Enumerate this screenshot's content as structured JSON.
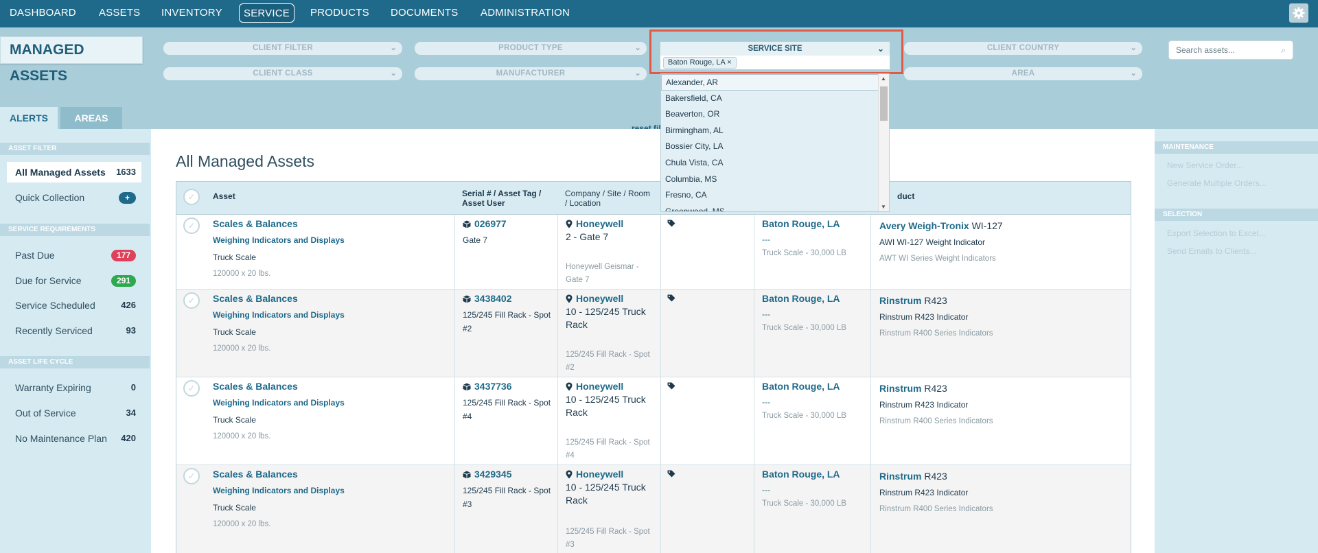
{
  "nav": {
    "items": [
      "DASHBOARD",
      "ASSETS",
      "INVENTORY",
      "SERVICE",
      "PRODUCTS",
      "DOCUMENTS",
      "ADMINISTRATION"
    ],
    "active": "SERVICE",
    "settings_icon": "gear-icon"
  },
  "page_title": "MANAGED ASSETS",
  "filters": {
    "client_filter": "CLIENT FILTER",
    "product_type": "PRODUCT TYPE",
    "service_site": "SERVICE SITE",
    "client_country": "CLIENT COUNTRY",
    "client_class": "CLIENT CLASS",
    "manufacturer": "MANUFACTURER",
    "area": "AREA",
    "selected_site": "Baton Rouge, LA",
    "search_placeholder": "Search assets...",
    "reset_label": "reset fil"
  },
  "site_options": [
    "Alexander, AR",
    "Bakersfield, CA",
    "Beaverton, OR",
    "Birmingham, AL",
    "Bossier City, LA",
    "Chula Vista, CA",
    "Columbia, MS",
    "Fresno, CA",
    "Greenwood, MS"
  ],
  "tabs": [
    "ALERTS",
    "AREAS"
  ],
  "sidebar": {
    "asset_filter_header": "ASSET FILTER",
    "all_assets": {
      "label": "All Managed Assets",
      "count": "1633"
    },
    "quick_collection": {
      "label": "Quick Collection",
      "badge": "+"
    },
    "service_req_header": "SERVICE REQUIREMENTS",
    "past_due": {
      "label": "Past Due",
      "count": "177"
    },
    "due_for_service": {
      "label": "Due for Service",
      "count": "291"
    },
    "service_scheduled": {
      "label": "Service Scheduled",
      "count": "426"
    },
    "recently_serviced": {
      "label": "Recently Serviced",
      "count": "93"
    },
    "life_cycle_header": "ASSET LIFE CYCLE",
    "warranty_expiring": {
      "label": "Warranty Expiring",
      "count": "0"
    },
    "out_of_service": {
      "label": "Out of Service",
      "count": "34"
    },
    "no_maintenance": {
      "label": "No Maintenance Plan",
      "count": "420"
    },
    "colors": {
      "red": "#e0415a",
      "green": "#2fa84f",
      "navy": "#1f6a8a"
    }
  },
  "main": {
    "title": "All Managed Assets",
    "headers": {
      "asset": "Asset",
      "serial_line1": "Serial # / Asset Tag /",
      "serial_line2": "Asset User",
      "company_line1": "Company / Site / Room",
      "company_line2": "/ Location",
      "product": "duct"
    },
    "rows": [
      {
        "asset": "Scales & Balances",
        "category": "Weighing Indicators and Displays",
        "type": "Truck Scale",
        "capacity": "120000 x 20 lbs.",
        "serial": "026977",
        "tag_line1": "Gate 7",
        "tag_line2": "",
        "company": "Honeywell",
        "room_line1": "2 - Gate 7",
        "room_line2": "",
        "loc_line1": "Honeywell Geismar -",
        "loc_line2": "Gate 7",
        "site": "Baton Rouge, LA",
        "site_dash": "---",
        "site_desc": "Truck Scale - 30,000 LB",
        "brand": "Avery Weigh-Tronix",
        "model": "WI-127",
        "prod_name": "AWI WI-127 Weight Indicator",
        "series": "AWT WI Series Weight Indicators"
      },
      {
        "asset": "Scales & Balances",
        "category": "Weighing Indicators and Displays",
        "type": "Truck Scale",
        "capacity": "120000 x 20 lbs.",
        "serial": "3438402",
        "tag_line1": "125/245 Fill Rack - Spot",
        "tag_line2": "#2",
        "company": "Honeywell",
        "room_line1": "10 - 125/245 Truck",
        "room_line2": "Rack",
        "loc_line1": "125/245 Fill Rack - Spot",
        "loc_line2": "#2",
        "site": "Baton Rouge, LA",
        "site_dash": "---",
        "site_desc": "Truck Scale - 30,000 LB",
        "brand": "Rinstrum",
        "model": "R423",
        "prod_name": "Rinstrum R423 Indicator",
        "series": "Rinstrum R400 Series Indicators"
      },
      {
        "asset": "Scales & Balances",
        "category": "Weighing Indicators and Displays",
        "type": "Truck Scale",
        "capacity": "120000 x 20 lbs.",
        "serial": "3437736",
        "tag_line1": "125/245 Fill Rack - Spot",
        "tag_line2": "#4",
        "company": "Honeywell",
        "room_line1": "10 - 125/245 Truck",
        "room_line2": "Rack",
        "loc_line1": "125/245 Fill Rack - Spot",
        "loc_line2": "#4",
        "site": "Baton Rouge, LA",
        "site_dash": "---",
        "site_desc": "Truck Scale - 30,000 LB",
        "brand": "Rinstrum",
        "model": "R423",
        "prod_name": "Rinstrum R423 Indicator",
        "series": "Rinstrum R400 Series Indicators"
      },
      {
        "asset": "Scales & Balances",
        "category": "Weighing Indicators and Displays",
        "type": "Truck Scale",
        "capacity": "120000 x 20 lbs.",
        "serial": "3429345",
        "tag_line1": "125/245 Fill Rack - Spot",
        "tag_line2": "#3",
        "company": "Honeywell",
        "room_line1": "10 - 125/245 Truck",
        "room_line2": "Rack",
        "loc_line1": "125/245 Fill Rack - Spot",
        "loc_line2": "#3",
        "site": "Baton Rouge, LA",
        "site_dash": "---",
        "site_desc": "Truck Scale - 30,000 LB",
        "brand": "Rinstrum",
        "model": "R423",
        "prod_name": "Rinstrum R423 Indicator",
        "series": "Rinstrum R400 Series Indicators"
      }
    ]
  },
  "right_panel": {
    "maintenance_header": "MAINTENANCE",
    "new_order": "New Service Order...",
    "multiple_orders": "Generate Multiple Orders...",
    "selection_header": "SELECTION",
    "export_excel": "Export Selection to Excel...",
    "send_emails": "Send Emails to Clients..."
  }
}
